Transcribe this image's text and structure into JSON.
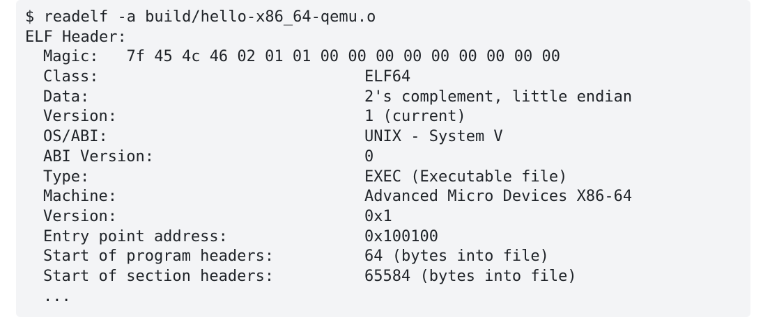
{
  "terminal": {
    "command": "$ readelf -a build/hello-x86_64-qemu.o",
    "section_title": "ELF Header:",
    "magic": {
      "key": "Magic:",
      "value": "7f 45 4c 46 02 01 01 00 00 00 00 00 00 00 00 00"
    },
    "fields": [
      {
        "key": "Class:",
        "value": "ELF64"
      },
      {
        "key": "Data:",
        "value": "2's complement, little endian"
      },
      {
        "key": "Version:",
        "value": "1 (current)"
      },
      {
        "key": "OS/ABI:",
        "value": "UNIX - System V"
      },
      {
        "key": "ABI Version:",
        "value": "0"
      },
      {
        "key": "Type:",
        "value": "EXEC (Executable file)"
      },
      {
        "key": "Machine:",
        "value": "Advanced Micro Devices X86-64"
      },
      {
        "key": "Version:",
        "value": "0x1"
      },
      {
        "key": "Entry point address:",
        "value": "0x100100"
      },
      {
        "key": "Start of program headers:",
        "value": "64 (bytes into file)"
      },
      {
        "key": "Start of section headers:",
        "value": "65584 (bytes into file)"
      }
    ],
    "ellipsis": "..."
  }
}
